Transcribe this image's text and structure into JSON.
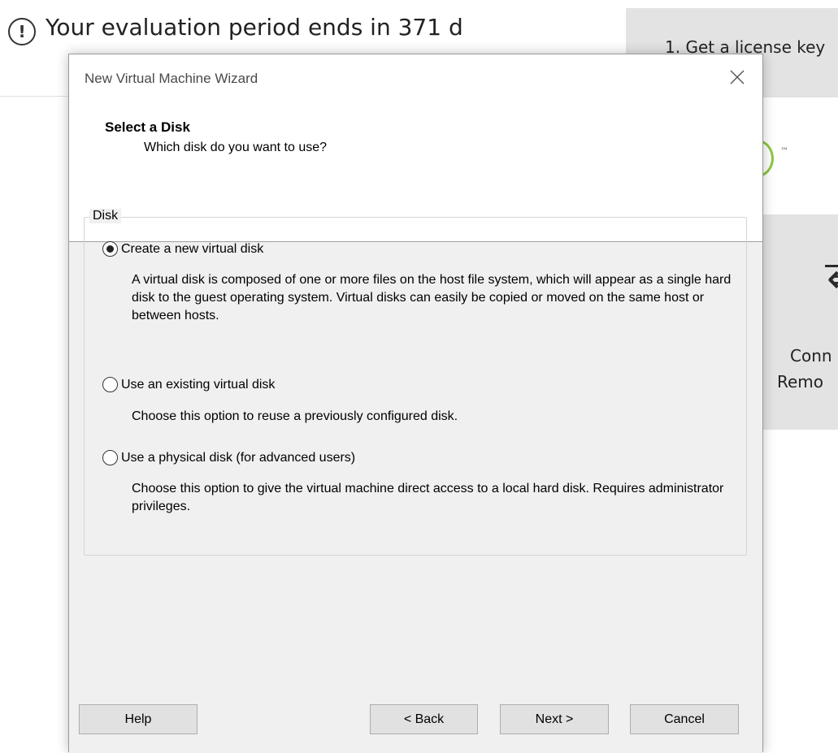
{
  "background": {
    "evaluation_notice": "Your evaluation period ends in 371 d",
    "license_button": "1. Get a license key",
    "remote_label_line1": "Conn",
    "remote_label_line2": "Remo"
  },
  "dialog": {
    "title": "New Virtual Machine Wizard",
    "header": {
      "title": "Select a Disk",
      "subtitle": "Which disk do you want to use?"
    },
    "group_label": "Disk",
    "options": [
      {
        "label": "Create a new virtual disk",
        "selected": true,
        "description": "A virtual disk is composed of one or more files on the host file system, which will appear as a single hard disk to the guest operating system. Virtual disks can easily be copied or moved on the same host or between hosts."
      },
      {
        "label": "Use an existing virtual disk",
        "selected": false,
        "description": "Choose this option to reuse a previously configured disk."
      },
      {
        "label": "Use a physical disk (for advanced users)",
        "selected": false,
        "description": "Choose this option to give the virtual machine direct access to a local hard disk. Requires administrator privileges."
      }
    ],
    "buttons": {
      "help": "Help",
      "back": "< Back",
      "next": "Next >",
      "cancel": "Cancel"
    }
  }
}
